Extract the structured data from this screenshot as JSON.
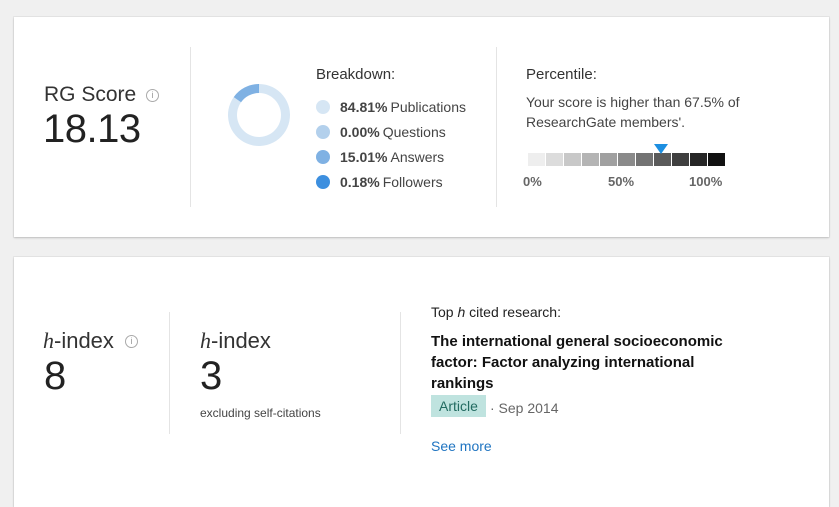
{
  "rg_score": {
    "label": "RG Score",
    "value": "18.13",
    "info_symbol": "i",
    "breakdown": {
      "title": "Breakdown:",
      "items": [
        {
          "pct": "84.81%",
          "label": "Publications",
          "color": "#d6e6f4"
        },
        {
          "pct": "0.00%",
          "label": "Questions",
          "color": "#b3d0ec"
        },
        {
          "pct": "15.01%",
          "label": "Answers",
          "color": "#7fb1e3"
        },
        {
          "pct": "0.18%",
          "label": "Followers",
          "color": "#3d8fdf"
        }
      ],
      "donut_fractions": [
        0.8481,
        0.0,
        0.1501,
        0.0018
      ]
    },
    "percentile": {
      "title": "Percentile:",
      "text": "Your score is higher than 67.5% of ResearchGate members'.",
      "value": 67.5,
      "marker_color": "#1d8fe1",
      "scale_colors": [
        "#eeeeee",
        "#dcdcdc",
        "#c8c8c8",
        "#b4b4b4",
        "#a0a0a0",
        "#8a8a8a",
        "#737373",
        "#5a5a5a",
        "#3f3f3f",
        "#262626",
        "#111111"
      ],
      "ticks": [
        "0%",
        "50%",
        "100%"
      ]
    }
  },
  "h_index": {
    "label_italic": "h",
    "label_rest": "-index",
    "value": "8",
    "info_symbol": "i",
    "excluding": {
      "label_italic": "h",
      "label_rest": "-index",
      "value": "3",
      "subtitle": "excluding self-citations"
    },
    "top_cited": {
      "title_pre": "Top ",
      "title_italic": "h",
      "title_post": " cited research:",
      "article_title": "The international general socioeconomic factor: Factor analyzing international rankings",
      "badge": "Article",
      "date": "· Sep 2014",
      "see_more": "See more"
    }
  }
}
